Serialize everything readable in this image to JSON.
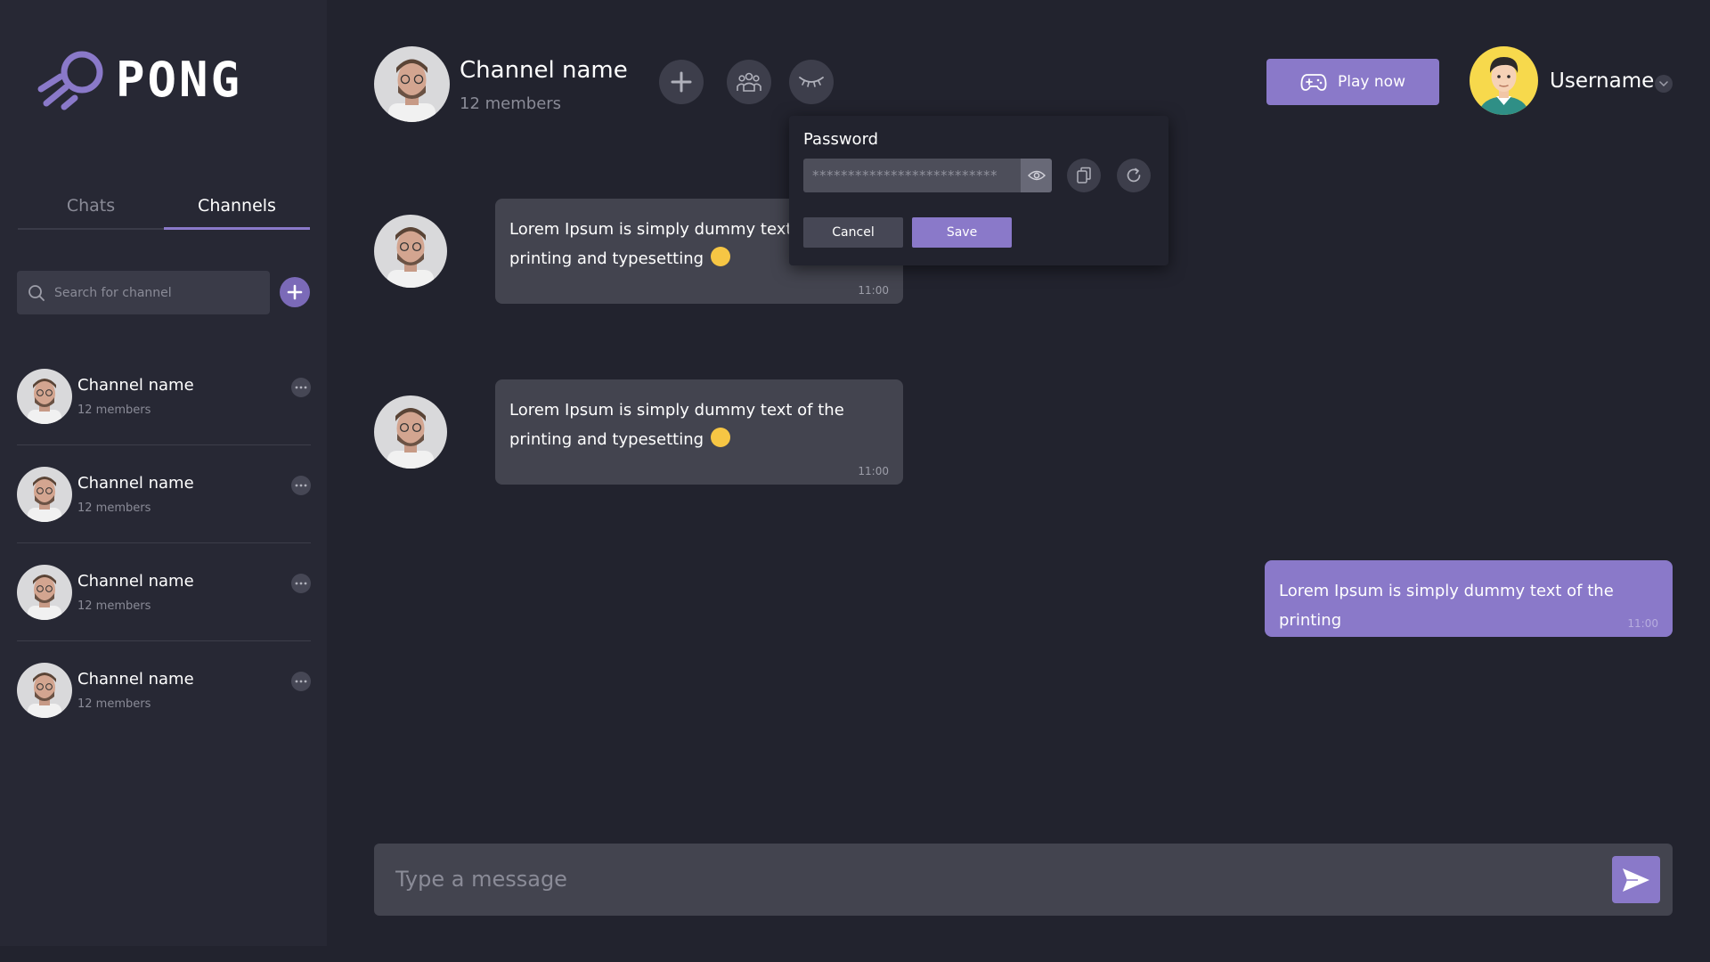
{
  "app": {
    "logo_text": "PONG"
  },
  "sidebar": {
    "tabs": [
      {
        "label": "Chats",
        "active": false
      },
      {
        "label": "Channels",
        "active": true
      }
    ],
    "search": {
      "placeholder": "Search for channel",
      "value": ""
    },
    "channels": [
      {
        "name": "Channel name",
        "members": "12 members"
      },
      {
        "name": "Channel name",
        "members": "12 members"
      },
      {
        "name": "Channel name",
        "members": "12 members"
      },
      {
        "name": "Channel name",
        "members": "12 members"
      }
    ]
  },
  "header": {
    "channel_name": "Channel name",
    "members": "12 members",
    "play_label": "Play now",
    "username": "Username"
  },
  "password_popup": {
    "title": "Password",
    "masked_value": "**************************",
    "cancel_label": "Cancel",
    "save_label": "Save"
  },
  "messages": [
    {
      "text": "Lorem Ipsum is simply dummy text of the printing and typesetting",
      "time": "11:00",
      "mine": false
    },
    {
      "text": "Lorem Ipsum is simply dummy text of the printing and typesetting",
      "time": "11:00",
      "mine": false
    },
    {
      "text": "Lorem Ipsum is simply dummy text of the printing",
      "time": "11:00",
      "mine": true
    }
  ],
  "composer": {
    "placeholder": "Type a message",
    "value": ""
  },
  "colors": {
    "background": "#22232e",
    "sidebar": "#272834",
    "accent": "#8a79c9",
    "bubble": "#43444f",
    "muted_text": "#8a8b97"
  }
}
